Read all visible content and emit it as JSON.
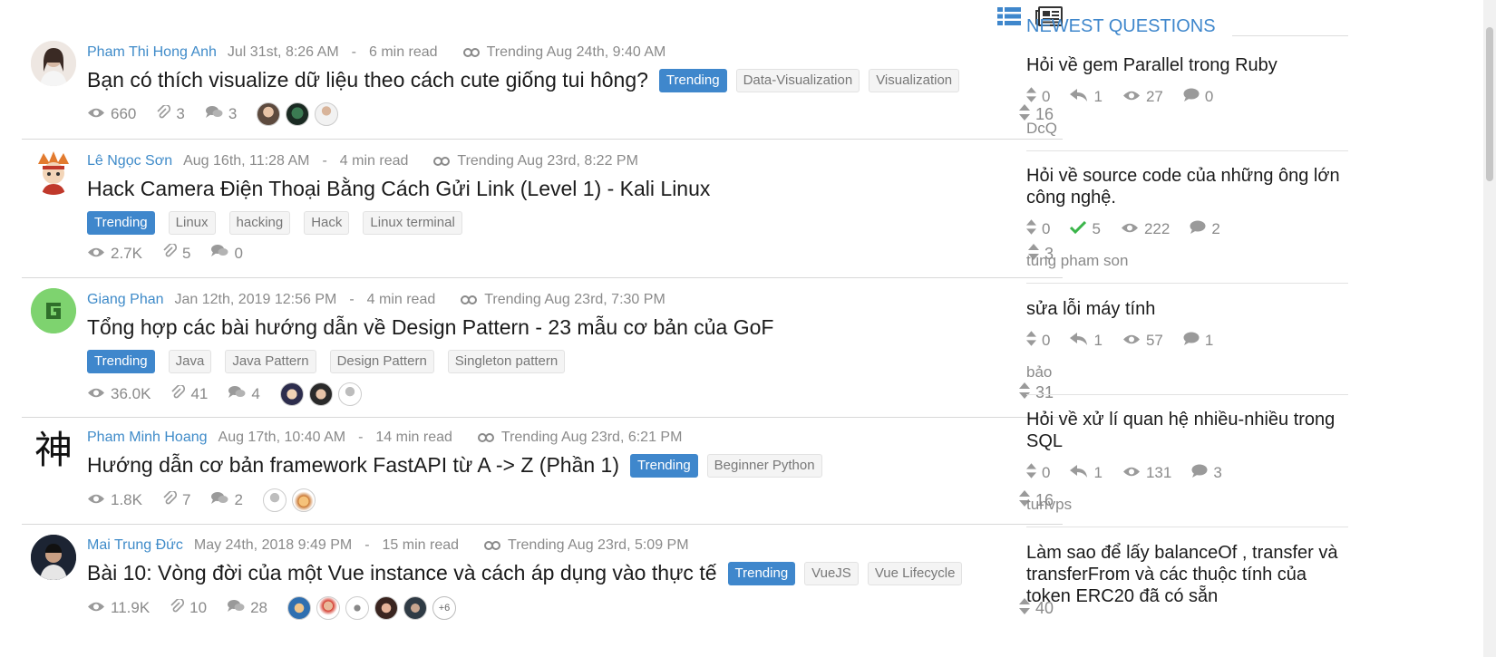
{
  "view_toggle": {
    "list_icon": "list-view-icon",
    "card_icon": "newspaper-view-icon"
  },
  "posts": [
    {
      "author": "Pham Thi Hong Anh",
      "date": "Jul 31st, 8:26 AM",
      "read": "6 min read",
      "trending_note": "Trending Aug 24th, 9:40 AM",
      "title": "Bạn có thích visualize dữ liệu theo cách cute giống tui hông?",
      "tags": [
        "Trending",
        "Data-Visualization",
        "Visualization"
      ],
      "views": "660",
      "clips": "3",
      "comments": "3",
      "points": "16"
    },
    {
      "author": "Lê Ngọc Sơn",
      "date": "Aug 16th, 11:28 AM",
      "read": "4 min read",
      "trending_note": "Trending Aug 23rd, 8:22 PM",
      "title": "Hack Camera Điện Thoại Bằng Cách Gửi Link (Level 1) - Kali Linux",
      "tags": [
        "Trending",
        "Linux",
        "hacking",
        "Hack",
        "Linux terminal"
      ],
      "views": "2.7K",
      "clips": "5",
      "comments": "0",
      "points": "3"
    },
    {
      "author": "Giang Phan",
      "date": "Jan 12th, 2019 12:56 PM",
      "read": "4 min read",
      "trending_note": "Trending Aug 23rd, 7:30 PM",
      "title": "Tổng hợp các bài hướng dẫn về Design Pattern - 23 mẫu cơ bản của GoF",
      "tags": [
        "Trending",
        "Java",
        "Java Pattern",
        "Design Pattern",
        "Singleton pattern"
      ],
      "views": "36.0K",
      "clips": "41",
      "comments": "4",
      "points": "31"
    },
    {
      "author": "Pham Minh Hoang",
      "date": "Aug 17th, 10:40 AM",
      "read": "14 min read",
      "trending_note": "Trending Aug 23rd, 6:21 PM",
      "title": "Hướng dẫn cơ bản framework FastAPI từ A -> Z (Phần 1)",
      "tags": [
        "Trending",
        "Beginner Python"
      ],
      "views": "1.8K",
      "clips": "7",
      "comments": "2",
      "points": "16",
      "avatar_glyph": "神"
    },
    {
      "author": "Mai Trung Đức",
      "date": "May 24th, 2018 9:49 PM",
      "read": "15 min read",
      "trending_note": "Trending Aug 23rd, 5:09 PM",
      "title": "Bài 10: Vòng đời của một Vue instance và cách áp dụng vào thực tế",
      "tags": [
        "Trending",
        "VueJS",
        "Vue Lifecycle"
      ],
      "views": "11.9K",
      "clips": "10",
      "comments": "28",
      "points": "40",
      "more_commenters": "+6"
    }
  ],
  "sidebar": {
    "heading": "NEWEST QUESTIONS",
    "questions": [
      {
        "title": "Hỏi về gem Parallel trong Ruby",
        "votes": "0",
        "answers": "1",
        "answer_icon": "reply-icon",
        "views": "27",
        "comments": "0",
        "author": "DcQ"
      },
      {
        "title": "Hỏi về source code của những ông lớn công nghệ.",
        "votes": "0",
        "answers": "5",
        "answer_icon": "check-icon",
        "views": "222",
        "comments": "2",
        "author": "tung pham son"
      },
      {
        "title": "sửa lỗi máy tính",
        "votes": "0",
        "answers": "1",
        "answer_icon": "reply-icon",
        "views": "57",
        "comments": "1",
        "author": "bảo"
      },
      {
        "title": "Hỏi về xử lí quan hệ nhiều-nhiều trong SQL",
        "votes": "0",
        "answers": "1",
        "answer_icon": "reply-icon",
        "views": "131",
        "comments": "3",
        "author": "tunvps"
      },
      {
        "title": "Làm sao để lấy balanceOf , transfer và transferFrom và các thuộc tính của token ERC20 đã có sẵn",
        "votes": "",
        "answers": "",
        "answer_icon": "reply-icon",
        "views": "",
        "comments": "",
        "author": ""
      }
    ]
  },
  "colors": {
    "accent": "#3f87cc",
    "muted": "#8a8a8a",
    "answered": "#3bb54a"
  }
}
